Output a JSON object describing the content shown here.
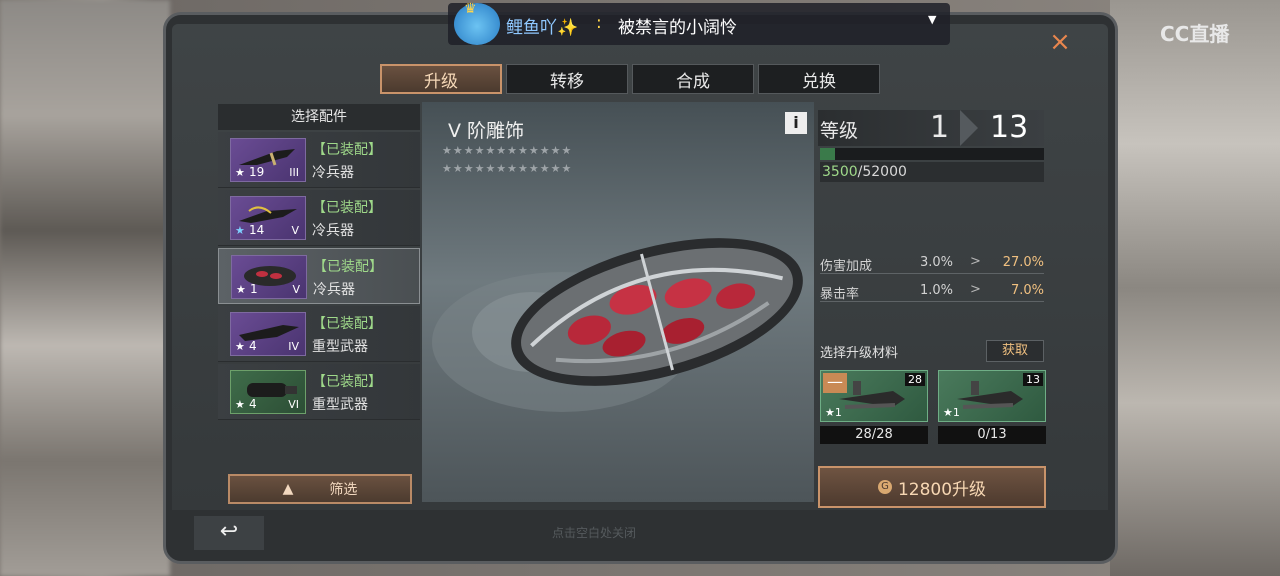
{
  "tabs": [
    {
      "label": "升级",
      "active": true
    },
    {
      "label": "转移",
      "active": false
    },
    {
      "label": "合成",
      "active": false
    },
    {
      "label": "兑换",
      "active": false
    }
  ],
  "close_icon": "×",
  "left_panel": {
    "title": "选择配件",
    "items": [
      {
        "star": "★",
        "level": "19",
        "tier": "III",
        "status": "【已装配】",
        "type": "冷兵器",
        "star_color": "#ffffff"
      },
      {
        "star": "★",
        "level": "14",
        "tier": "V",
        "status": "【已装配】",
        "type": "冷兵器",
        "star_color": "#7fd0ff"
      },
      {
        "star": "★",
        "level": "1",
        "tier": "V",
        "status": "【已装配】",
        "type": "冷兵器",
        "star_color": "#ffffff"
      },
      {
        "star": "★",
        "level": "4",
        "tier": "IV",
        "status": "【已装配】",
        "type": "重型武器",
        "star_color": "#ffffff"
      },
      {
        "star": "★",
        "level": "4",
        "tier": "VI",
        "status": "【已装配】",
        "type": "重型武器",
        "star_color": "#ffffff"
      }
    ],
    "filter_label": "筛选",
    "filter_icon": "▲"
  },
  "center": {
    "name": "V 阶雕饰",
    "stars_row1": "★★★★★★★★★★★★",
    "stars_row2": "★★★★★★★★★★★★",
    "info": "i"
  },
  "right_panel": {
    "level_label": "等级",
    "level_from": "1",
    "level_to": "13",
    "exp_current": "3500",
    "exp_max": "/52000",
    "exp_fraction": 0.067,
    "stats": [
      {
        "name": "伤害加成",
        "before": "3.0%",
        "after": "27.0%"
      },
      {
        "name": "暴击率",
        "before": "1.0%",
        "after": "7.0%"
      }
    ],
    "stat_arrow": ">",
    "materials_label": "选择升级材料",
    "obtain_label": "获取",
    "materials": [
      {
        "count": "28",
        "star": "★1",
        "qty": "28/28",
        "minus": "—"
      },
      {
        "count": "13",
        "star": "★1",
        "qty": "0/13"
      }
    ],
    "upgrade_label": "12800升级",
    "currency_icon": "G"
  },
  "bottom": {
    "back_icon": "↩",
    "hint": "点击空白处关闭"
  },
  "danmaku": {
    "name": "鲤鱼吖",
    "sparkle": "✨",
    "sep": ":",
    "text": "被禁言的小阔怜",
    "caret": "▼"
  },
  "watermark": "CC直播"
}
